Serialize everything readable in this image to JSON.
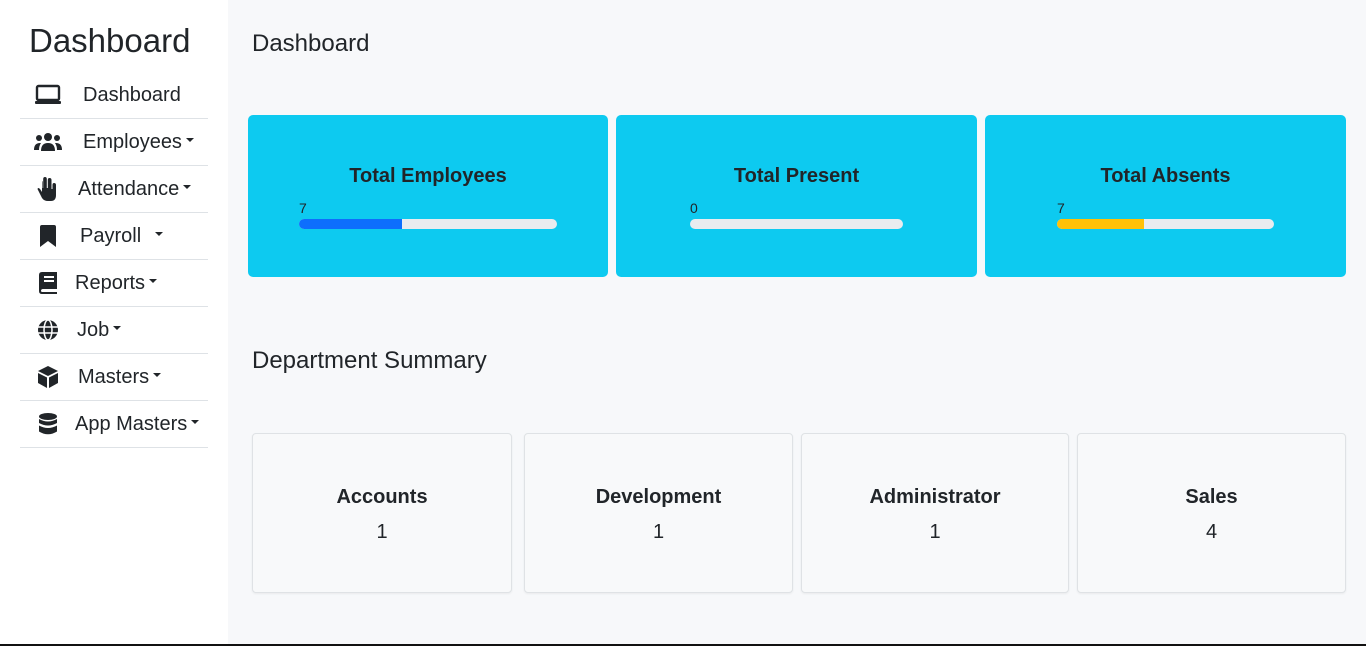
{
  "sidebar": {
    "brand": "Dashboard",
    "items": [
      {
        "label": "Dashboard",
        "icon": "monitor-icon",
        "has_caret": false
      },
      {
        "label": "Employees",
        "icon": "users-icon",
        "has_caret": true
      },
      {
        "label": "Attendance",
        "icon": "hand-icon",
        "has_caret": true
      },
      {
        "label": "Payroll",
        "icon": "bookmark-icon",
        "has_caret": true
      },
      {
        "label": "Reports",
        "icon": "book-icon",
        "has_caret": true
      },
      {
        "label": "Job",
        "icon": "globe-icon",
        "has_caret": true
      },
      {
        "label": "Masters",
        "icon": "cube-icon",
        "has_caret": true
      },
      {
        "label": "App Masters",
        "icon": "database-icon",
        "has_caret": true
      }
    ]
  },
  "main": {
    "title": "Dashboard",
    "stats": [
      {
        "title": "Total Employees",
        "count": "7",
        "progress": 0.4,
        "bar_color": "#0d6efd"
      },
      {
        "title": "Total Present",
        "count": "0",
        "progress": 0.0,
        "bar_color": "#0d6efd"
      },
      {
        "title": "Total Absents",
        "count": "7",
        "progress": 0.4,
        "bar_color": "#ffc107"
      }
    ],
    "department_title": "Department Summary",
    "departments": [
      {
        "name": "Accounts",
        "count": "1"
      },
      {
        "name": "Development",
        "count": "1"
      },
      {
        "name": "Administrator",
        "count": "1"
      },
      {
        "name": "Sales",
        "count": "4"
      }
    ]
  },
  "colors": {
    "card_bg": "#0dcaf0",
    "bar_track": "#e9ecef",
    "main_bg": "#f7f8fa"
  }
}
